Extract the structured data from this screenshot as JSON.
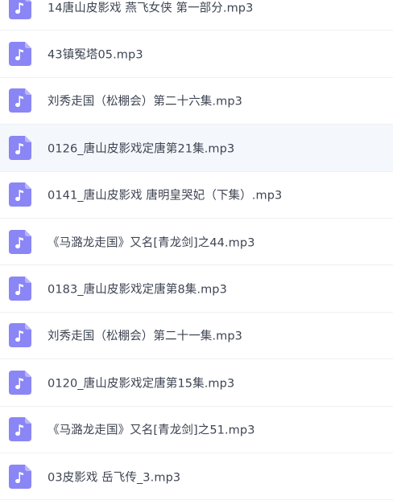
{
  "accent_color": "#8b86f5",
  "file_icon": "music-file-icon",
  "files": [
    {
      "name": "14唐山皮影戏 燕飞女侠 第一部分.mp3"
    },
    {
      "name": "43镇冤塔05.mp3"
    },
    {
      "name": "刘秀走国（松棚会）第二十六集.mp3"
    },
    {
      "name": "0126_唐山皮影戏定唐第21集.mp3"
    },
    {
      "name": "0141_唐山皮影戏 唐明皇哭妃（下集）.mp3"
    },
    {
      "name": "《马潞龙走国》又名[青龙剑]之44.mp3"
    },
    {
      "name": "0183_唐山皮影戏定唐第8集.mp3"
    },
    {
      "name": "刘秀走国（松棚会）第二十一集.mp3"
    },
    {
      "name": "0120_唐山皮影戏定唐第15集.mp3"
    },
    {
      "name": "《马潞龙走国》又名[青龙剑]之51.mp3"
    },
    {
      "name": "03皮影戏 岳飞传_3.mp3"
    }
  ]
}
